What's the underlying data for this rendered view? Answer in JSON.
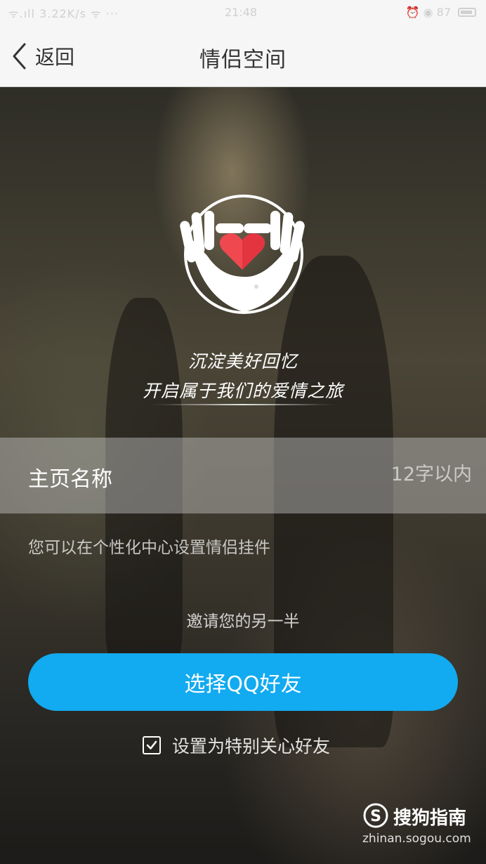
{
  "status_bar": {
    "signal": "ᯤ.ıll 3.22K/s ᯤ ···",
    "time": "21:48",
    "right_icons": "⏰ ◉ 87"
  },
  "header": {
    "back_label": "返回",
    "title": "情侣空间"
  },
  "slogan": {
    "line1": "沉淀美好回忆",
    "line2": "开启属于我们的爱情之旅"
  },
  "name_row": {
    "label": "主页名称",
    "placeholder": "12字以内"
  },
  "hint": "您可以在个性化中心设置情侣挂件",
  "invite": "邀请您的另一半",
  "select_button_label": "选择QQ好友",
  "checkbox": {
    "label": "设置为特别关心好友",
    "checked": true
  },
  "watermark": {
    "brand": "搜狗指南",
    "url": "zhinan.sogou.com"
  },
  "colors": {
    "accent": "#12aaf0",
    "heart": "#f0484f",
    "header_bg": "#f6f6f6"
  }
}
